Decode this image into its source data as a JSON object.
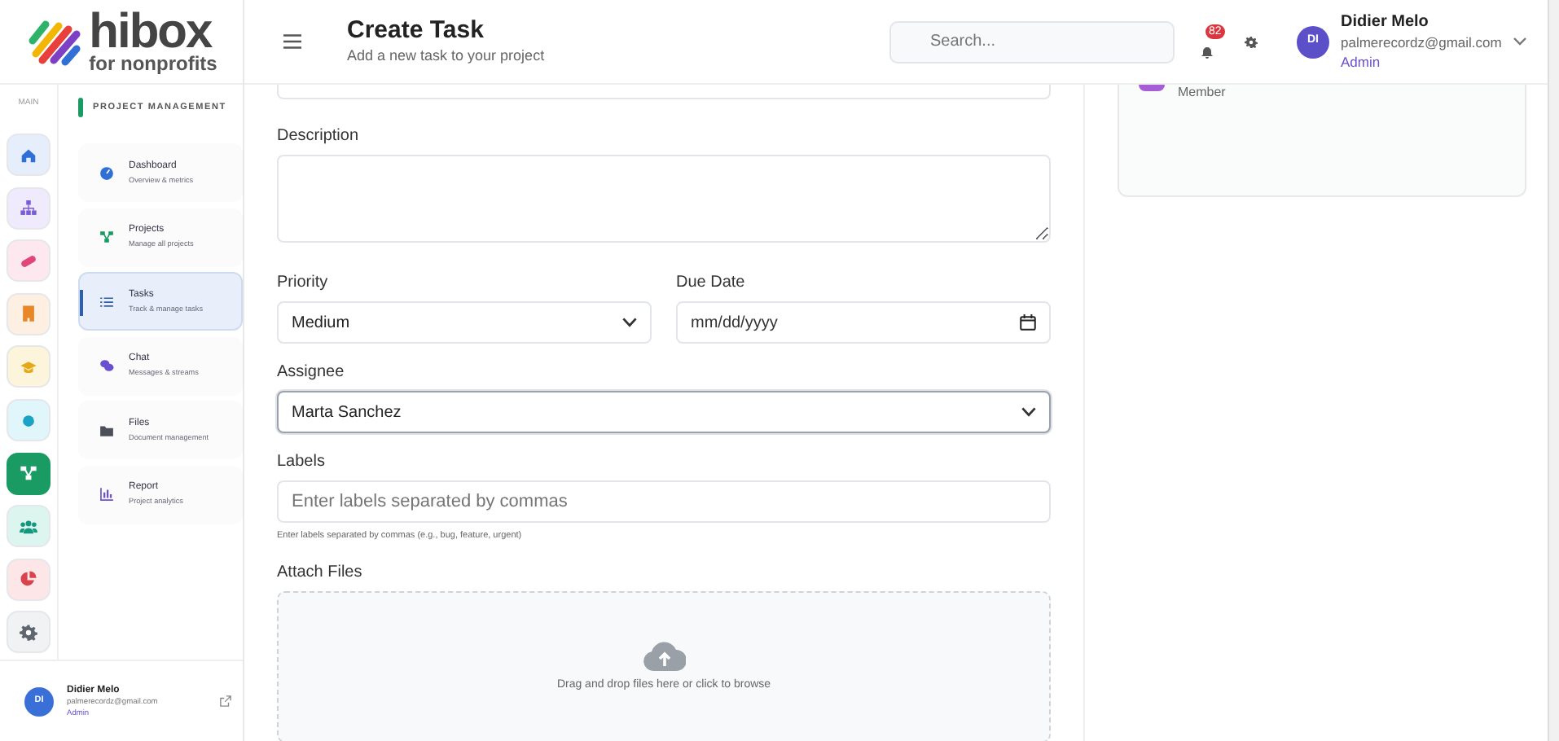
{
  "logo": {
    "name": "hibox",
    "tagline": "for nonprofits"
  },
  "rail": {
    "label": "MAIN",
    "items": [
      {
        "selected": false
      },
      {
        "selected": false
      },
      {
        "selected": false
      },
      {
        "selected": false
      },
      {
        "selected": false
      },
      {
        "selected": false
      },
      {
        "selected": true
      },
      {
        "selected": false
      },
      {
        "selected": false
      },
      {
        "selected": false
      }
    ]
  },
  "nav": {
    "section": "PROJECT MANAGEMENT",
    "items": [
      {
        "title": "Dashboard",
        "subtitle": "Overview & metrics",
        "selected": false
      },
      {
        "title": "Projects",
        "subtitle": "Manage all projects",
        "selected": false
      },
      {
        "title": "Tasks",
        "subtitle": "Track & manage tasks",
        "selected": true
      },
      {
        "title": "Chat",
        "subtitle": "Messages & streams",
        "selected": false
      },
      {
        "title": "Files",
        "subtitle": "Document management",
        "selected": false
      },
      {
        "title": "Report",
        "subtitle": "Project analytics",
        "selected": false
      }
    ]
  },
  "sidebar_user": {
    "initials": "DI",
    "name": "Didier Melo",
    "email": "palmerecordz@gmail.com",
    "role": "Admin"
  },
  "header": {
    "title": "Create Task",
    "subtitle": "Add a new task to your project",
    "search": {
      "placeholder": "Search..."
    },
    "notifications": "82",
    "user": {
      "initials": "DI",
      "name": "Didier Melo",
      "email": "palmerecordz@gmail.com",
      "role": "Admin"
    }
  },
  "form": {
    "description": {
      "label": "Description"
    },
    "priority": {
      "label": "Priority",
      "value": "Medium"
    },
    "due_date": {
      "label": "Due Date",
      "placeholder": "mm/dd/yyyy"
    },
    "assignee": {
      "label": "Assignee",
      "value": "Marta Sanchez",
      "focused": true
    },
    "labels": {
      "label": "Labels",
      "placeholder": "Enter labels separated by commas",
      "help": "Enter labels separated by commas (e.g., bug, feature, urgent)"
    },
    "attach": {
      "label": "Attach Files",
      "hint": "Drag and drop files here or click to browse"
    }
  },
  "side_card": {
    "member_role": "Member"
  }
}
